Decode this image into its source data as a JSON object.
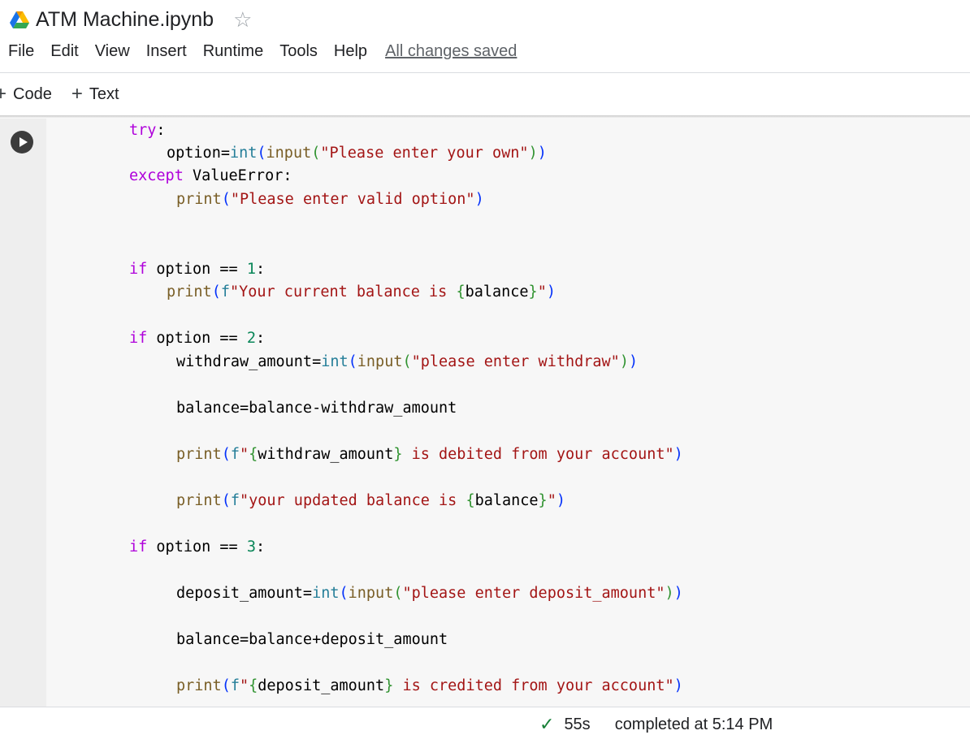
{
  "header": {
    "title": "ATM Machine.ipynb",
    "icons": {
      "app": "google-drive-icon",
      "star": "star-outline-icon"
    }
  },
  "menu": {
    "items": [
      "File",
      "Edit",
      "View",
      "Insert",
      "Runtime",
      "Tools",
      "Help"
    ],
    "save_status": "All changes saved"
  },
  "toolbar": {
    "code_label": "Code",
    "text_label": "Text"
  },
  "code_lines": [
    [
      [
        "kw",
        "try"
      ],
      [
        "pl",
        ":"
      ]
    ],
    [
      [
        "pl",
        "option="
      ],
      [
        "bi",
        "int"
      ],
      [
        "p1",
        "("
      ],
      [
        "fn",
        "input"
      ],
      [
        "p2",
        "("
      ],
      [
        "str",
        "\"Please enter your own\""
      ],
      [
        "p2",
        ")"
      ],
      [
        "p1",
        ")"
      ]
    ],
    [
      [
        "kw",
        "except"
      ],
      [
        "pl",
        " ValueError:"
      ]
    ],
    [
      [
        "fn",
        "print"
      ],
      [
        "p1",
        "("
      ],
      [
        "str",
        "\"Please enter valid option\""
      ],
      [
        "p1",
        ")"
      ]
    ],
    [
      [
        "kw",
        "if"
      ],
      [
        "pl",
        " option == "
      ],
      [
        "num",
        "1"
      ],
      [
        "pl",
        ":"
      ]
    ],
    [
      [
        "fn",
        "print"
      ],
      [
        "p1",
        "("
      ],
      [
        "bi",
        "f"
      ],
      [
        "str",
        "\"Your current balance is "
      ],
      [
        "p2",
        "{"
      ],
      [
        "pl",
        "balance"
      ],
      [
        "p2",
        "}"
      ],
      [
        "str",
        "\""
      ],
      [
        "p1",
        ")"
      ]
    ],
    [
      [
        "kw",
        "if"
      ],
      [
        "pl",
        " option == "
      ],
      [
        "num",
        "2"
      ],
      [
        "pl",
        ":"
      ]
    ],
    [
      [
        "pl",
        "withdraw_amount="
      ],
      [
        "bi",
        "int"
      ],
      [
        "p1",
        "("
      ],
      [
        "fn",
        "input"
      ],
      [
        "p2",
        "("
      ],
      [
        "str",
        "\"please enter withdraw\""
      ],
      [
        "p2",
        ")"
      ],
      [
        "p1",
        ")"
      ]
    ],
    [
      [
        "pl",
        "balance=balance-withdraw_amount"
      ]
    ],
    [
      [
        "fn",
        "print"
      ],
      [
        "p1",
        "("
      ],
      [
        "bi",
        "f"
      ],
      [
        "str",
        "\""
      ],
      [
        "p2",
        "{"
      ],
      [
        "pl",
        "withdraw_amount"
      ],
      [
        "p2",
        "}"
      ],
      [
        "str",
        " is debited from your account\""
      ],
      [
        "p1",
        ")"
      ]
    ],
    [
      [
        "fn",
        "print"
      ],
      [
        "p1",
        "("
      ],
      [
        "bi",
        "f"
      ],
      [
        "str",
        "\"your updated balance is "
      ],
      [
        "p2",
        "{"
      ],
      [
        "pl",
        "balance"
      ],
      [
        "p2",
        "}"
      ],
      [
        "str",
        "\""
      ],
      [
        "p1",
        ")"
      ]
    ],
    [
      [
        "kw",
        "if"
      ],
      [
        "pl",
        " option == "
      ],
      [
        "num",
        "3"
      ],
      [
        "pl",
        ":"
      ]
    ],
    [
      [
        "pl",
        "deposit_amount="
      ],
      [
        "bi",
        "int"
      ],
      [
        "p1",
        "("
      ],
      [
        "fn",
        "input"
      ],
      [
        "p2",
        "("
      ],
      [
        "str",
        "\"please enter deposit_amount\""
      ],
      [
        "p2",
        ")"
      ],
      [
        "p1",
        ")"
      ]
    ],
    [
      [
        "pl",
        "balance=balance+deposit_amount"
      ]
    ],
    [
      [
        "fn",
        "print"
      ],
      [
        "p1",
        "("
      ],
      [
        "bi",
        "f"
      ],
      [
        "str",
        "\""
      ],
      [
        "p2",
        "{"
      ],
      [
        "pl",
        "deposit_amount"
      ],
      [
        "p2",
        "}"
      ],
      [
        "str",
        " is credited from your account\""
      ],
      [
        "p1",
        ")"
      ]
    ]
  ],
  "status": {
    "duration": "55s",
    "completed": "completed at 5:14 PM",
    "icon": "check-icon"
  }
}
